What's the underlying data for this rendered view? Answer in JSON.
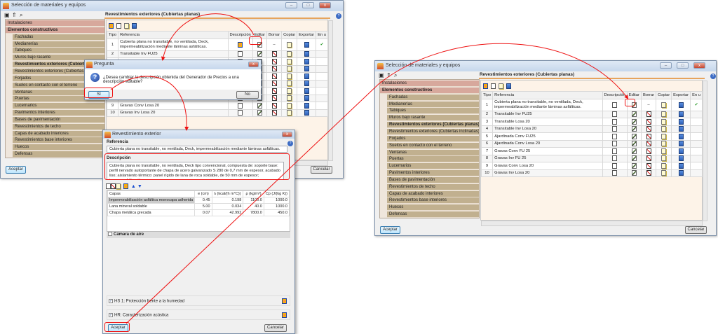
{
  "window": {
    "title": "Selección de materiales y equipos",
    "panel_title": "Revestimientos exteriores (Cubiertas planas)",
    "tree": [
      {
        "label": "Instalaciones",
        "level": 0
      },
      {
        "label": "Elementos constructivos",
        "level": 0,
        "bold": true
      },
      {
        "label": "Fachadas",
        "level": 1
      },
      {
        "label": "Medianerías",
        "level": 1
      },
      {
        "label": "Tabiques",
        "level": 1
      },
      {
        "label": "Muros bajo rasante",
        "level": 1
      },
      {
        "label": "Revestimientos exteriores (Cubiertas planas)",
        "level": 1,
        "bold": true,
        "selected": true
      },
      {
        "label": "Revestimientos exteriores (Cubiertas inclinadas)",
        "level": 1
      },
      {
        "label": "Forjados",
        "level": 1
      },
      {
        "label": "Suelos en contacto con el terreno",
        "level": 1
      },
      {
        "label": "Ventanas",
        "level": 1
      },
      {
        "label": "Puertas",
        "level": 1
      },
      {
        "label": "Lucernarios",
        "level": 1
      },
      {
        "label": "Pavimentos interiores",
        "level": 1
      },
      {
        "label": "Bases de pavimentación",
        "level": 1
      },
      {
        "label": "Revestimientos de techo",
        "level": 1
      },
      {
        "label": "Capas de acabado interiores",
        "level": 1
      },
      {
        "label": "Revestimientos base interiores",
        "level": 1
      },
      {
        "label": "Huecos",
        "level": 1
      },
      {
        "label": "Defensas",
        "level": 1
      }
    ],
    "columns": [
      "Tipo",
      "Referencia",
      "Descripción",
      "Editar",
      "Borrar",
      "Copiar",
      "Exportar",
      "En u"
    ],
    "rows": [
      {
        "tipo": "1",
        "ref": "Cubierta plana no transitable, no ventilada, Deck, impermeabilización mediante láminas asfálticas.",
        "in_use": "✔"
      },
      {
        "tipo": "2",
        "ref": "Transitable Inv FU25"
      },
      {
        "tipo": "3",
        "ref": "Transitable Losa 20"
      },
      {
        "tipo": "4",
        "ref": "Transitable Inv Losa 20"
      },
      {
        "tipo": "5",
        "ref": "Ajardinada Conv FU25"
      },
      {
        "tipo": "6",
        "ref": "Ajardinada Conv Losa 20"
      },
      {
        "tipo": "7",
        "ref": "Gravas Conv FU 25"
      },
      {
        "tipo": "8",
        "ref": "Gravas Inv FU 25"
      },
      {
        "tipo": "9",
        "ref": "Gravas Conv Losa 20"
      },
      {
        "tipo": "10",
        "ref": "Gravas Inv Losa 20"
      }
    ],
    "accept": "Aceptar",
    "cancel": "Cancelar"
  },
  "left_row1_description_icon": "generator-price-icon",
  "right_row1_description_icon": "document-icon",
  "question_dialog": {
    "title": "Pregunta",
    "message": "¿Desea cambiar la descripción obtenida del Generador de Precios a una descripción editable?",
    "yes": "Sí",
    "no": "No"
  },
  "edit_dialog": {
    "title": "Revestimiento exterior",
    "reference_label": "Referencia",
    "reference_value": "Cubierta plana no transitable, no ventilada, Deck, impermeabilización mediante láminas asfálticas.",
    "description_label": "Descripción",
    "description_value": "Cubierta plana no transitable, no ventilada, Deck tipo convencional, compuesta de: soporte base: perfil nervado autoportante de chapa de acero galvanizado S 280 de 0,7 mm de espesor, acabado liso; aislamiento térmico: panel rígido de lana de roca soldable, de 50 mm de espesor; impermeabilización:",
    "layer_columns": [
      "Capas",
      "e (cm)",
      "λ (kcal/(h m°C))",
      "ρ (kg/m³)",
      "Cp (J/(kg K))"
    ],
    "layers": [
      [
        "Impermeabilización asfáltica monocapa adherida",
        "0.45",
        "0.198",
        "1100.0",
        "1000.0"
      ],
      [
        "Lana mineral soldable",
        "5.00",
        "0.034",
        "40.0",
        "1000.0"
      ],
      [
        "Chapa metálica grecada",
        "0.07",
        "42.992",
        "7800.0",
        "450.0"
      ]
    ],
    "air_chamber": "Cámara de aire",
    "hs1": "HS 1: Protección frente a la humedad",
    "hr": "HR: Caracterización acústica",
    "accept": "Aceptar",
    "cancel": "Cancelar"
  },
  "colors": {
    "highlight": "#e11111",
    "category": "#d7a89c",
    "subcategory": "#c1b08f"
  }
}
